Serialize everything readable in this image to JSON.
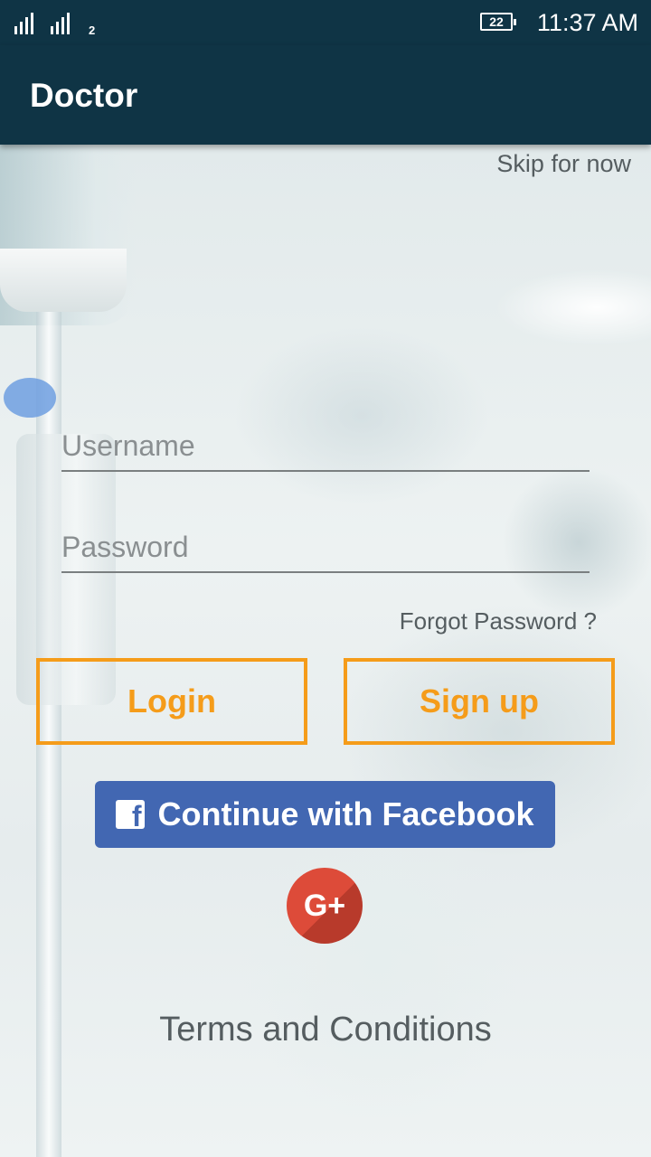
{
  "status_bar": {
    "sim_number": "2",
    "battery_level": "22",
    "time": "11:37 AM"
  },
  "app_bar": {
    "title": "Doctor"
  },
  "skip_label": "Skip for now",
  "login_form": {
    "username_placeholder": "Username",
    "username_value": "",
    "password_placeholder": "Password",
    "password_value": "",
    "forgot_password_label": "Forgot Password ?",
    "login_label": "Login",
    "signup_label": "Sign up"
  },
  "social": {
    "facebook_icon": "f",
    "facebook_label": "Continue with Facebook",
    "google_plus_label": "G+"
  },
  "terms_label": "Terms and Conditions",
  "colors": {
    "app_bar": "#0f3445",
    "accent_orange": "#f59c1a",
    "facebook_blue": "#4267b2",
    "google_red": "#dd4b39"
  },
  "icons": {
    "signal": "signal-bars-icon",
    "battery": "battery-icon",
    "facebook": "facebook-icon",
    "google_plus": "google-plus-icon"
  }
}
